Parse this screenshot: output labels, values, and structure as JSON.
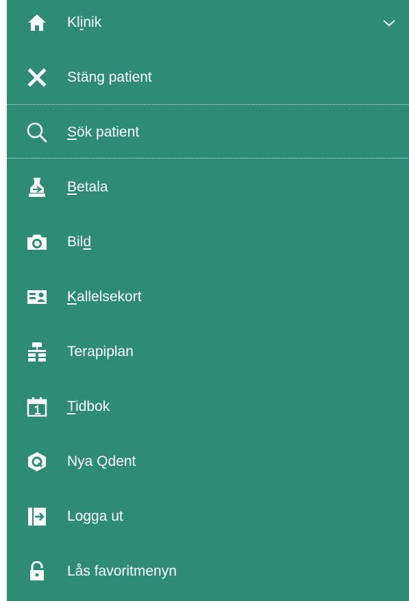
{
  "menu": {
    "background_color": "#2e8b74",
    "text_color": "#ffffff",
    "items": [
      {
        "icon": "home-icon",
        "label_parts": [
          "Kl",
          "i",
          "nik"
        ],
        "underline": 1,
        "has_chevron": true
      },
      {
        "icon": "close-icon",
        "label_parts": [
          "Stäng patient",
          "",
          ""
        ],
        "underline": -1
      },
      {
        "icon": "search-icon",
        "label_parts": [
          "",
          "S",
          "ök patient"
        ],
        "underline": 1
      },
      {
        "icon": "payment-icon",
        "label_parts": [
          "",
          "B",
          "etala"
        ],
        "underline": 1
      },
      {
        "icon": "camera-icon",
        "label_parts": [
          "Bil",
          "d",
          ""
        ],
        "underline": 1
      },
      {
        "icon": "id-card-icon",
        "label_parts": [
          "",
          "K",
          "allelsekort"
        ],
        "underline": 1
      },
      {
        "icon": "hierarchy-icon",
        "label_parts": [
          "Terapiplan",
          "",
          ""
        ],
        "underline": -1
      },
      {
        "icon": "calendar-icon",
        "label_parts": [
          "",
          "T",
          "idbok"
        ],
        "underline": 1
      },
      {
        "icon": "qdent-logo-icon",
        "label_parts": [
          "Nya Qdent",
          "",
          ""
        ],
        "underline": -1
      },
      {
        "icon": "logout-icon",
        "label_parts": [
          "Lo",
          "g",
          "ga ut"
        ],
        "underline": 1
      },
      {
        "icon": "unlock-icon",
        "label_parts": [
          "Lås favoritmenyn",
          "",
          ""
        ],
        "underline": -1
      }
    ]
  }
}
